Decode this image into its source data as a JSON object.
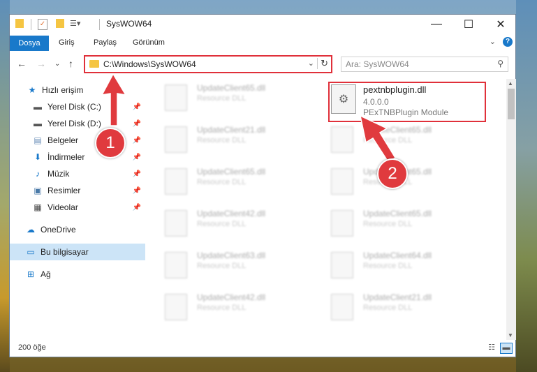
{
  "window": {
    "title": "SysWOW64",
    "minimize_glyph": "—",
    "maximize_glyph": "☐",
    "close_glyph": "✕"
  },
  "ribbon": {
    "file_tab": "Dosya",
    "tabs": [
      "Giriş",
      "Paylaş",
      "Görünüm"
    ],
    "expand_glyph": "⌄",
    "help_glyph": "?"
  },
  "address": {
    "path": "C:\\Windows\\SysWOW64",
    "search_placeholder": "Ara: SysWOW64"
  },
  "sidebar": {
    "items": [
      {
        "label": "Hızlı erişim",
        "icon": "star-icon"
      },
      {
        "label": "Yerel Disk (C:)",
        "icon": "drive-icon"
      },
      {
        "label": "Yerel Disk (D:)",
        "icon": "drive-icon"
      },
      {
        "label": "Belgeler",
        "icon": "documents-icon"
      },
      {
        "label": "İndirmeler",
        "icon": "download-icon"
      },
      {
        "label": "Müzik",
        "icon": "music-icon"
      },
      {
        "label": "Resimler",
        "icon": "pictures-icon"
      },
      {
        "label": "Videolar",
        "icon": "video-icon"
      },
      {
        "label": "OneDrive",
        "icon": "cloud-icon"
      },
      {
        "label": "Bu bilgisayar",
        "icon": "computer-icon"
      },
      {
        "label": "Ağ",
        "icon": "network-icon"
      }
    ]
  },
  "files": {
    "left_column": [
      {
        "name": "UpdateClient65.dll",
        "type": "Resource DLL"
      },
      {
        "name": "UpdateClient21.dll",
        "type": "Resource DLL"
      },
      {
        "name": "UpdateClient65.dll",
        "type": "Resource DLL"
      },
      {
        "name": "UpdateClient42.dll",
        "type": "Resource DLL"
      },
      {
        "name": "UpdateClient63.dll",
        "type": "Resource DLL"
      },
      {
        "name": "UpdateClient42.dll",
        "type": "Resource DLL"
      }
    ],
    "right_column": [
      {
        "name": "UpdateClient65.dll",
        "type": "Resource DLL"
      },
      {
        "name": "UpdateClient65.dll",
        "type": "Resource DLL"
      },
      {
        "name": "UpdateClient65.dll",
        "type": "Resource DLL"
      },
      {
        "name": "UpdateClient64.dll",
        "type": "Resource DLL"
      },
      {
        "name": "UpdateClient21.dll",
        "type": "Resource DLL"
      }
    ],
    "highlighted": {
      "name": "pextnbplugin.dll",
      "version": "4.0.0.0",
      "description": "PExTNBPlugin Module"
    }
  },
  "status": {
    "item_count": "200 öğe"
  },
  "callouts": {
    "one": "1",
    "two": "2"
  },
  "colors": {
    "accent": "#1979ca",
    "highlight": "#e0303a"
  }
}
